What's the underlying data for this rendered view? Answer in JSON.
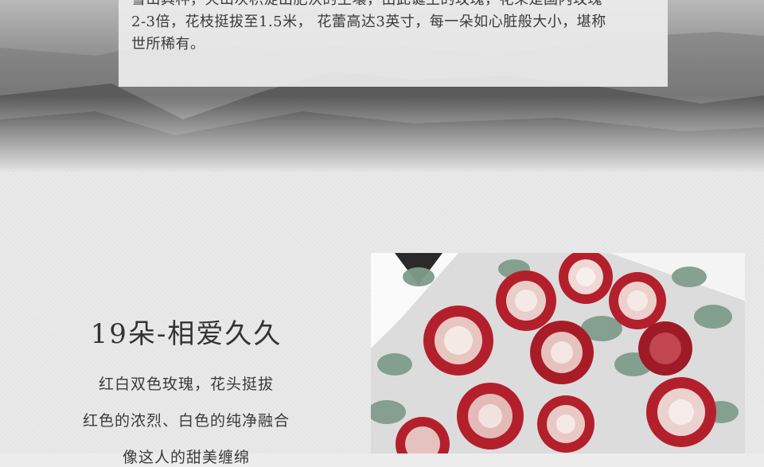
{
  "intro": {
    "lines": [
      "雪山具种，火山灰积淀出肥沃的土壤，由此诞生的玫瑰，花朵是国内玫瑰",
      "2-3倍，花枝挺拔至1.5米， 花蕾高达3英寸，每一朵如心脏般大小，堪称",
      "世所稀有。"
    ]
  },
  "product": {
    "title": "19朵-相爱久久",
    "desc": [
      "红白双色玫瑰，花头挺拔",
      "红色的浓烈、白色的纯净融合",
      "像这人的甜美缠绵"
    ]
  },
  "colors": {
    "rose_red": "#b3202c",
    "rose_white": "#f5e9e6",
    "leaf": "#7f9c8c"
  }
}
